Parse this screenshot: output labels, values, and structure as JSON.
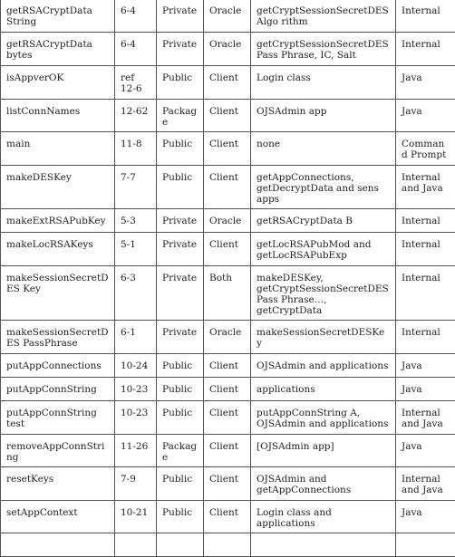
{
  "table": {
    "rows": [
      {
        "method": "getRSACryptData String",
        "ref": "6-4",
        "access": "Private",
        "location": "Oracle",
        "called_by": "getCryptSessionSecretDESAlgo rithm",
        "used_by": "Internal"
      },
      {
        "method": "getRSACryptData bytes",
        "ref": "6-4",
        "access": "Private",
        "location": "Oracle",
        "called_by": "getCryptSessionSecretDESPass Phrase, IC, Salt",
        "used_by": "Internal"
      },
      {
        "method": "isAppverOK",
        "ref": "ref 12-6",
        "access": "Public",
        "location": "Client",
        "called_by": "Login class",
        "used_by": "Java"
      },
      {
        "method": "listConnNames",
        "ref": "12-62",
        "access": "Package",
        "location": "Client",
        "called_by": "OJSAdmin app",
        "used_by": "Java"
      },
      {
        "method": "main",
        "ref": "11-8",
        "access": "Public",
        "location": "Client",
        "called_by": "none",
        "used_by": "Command Prompt"
      },
      {
        "method": "makeDESKey",
        "ref": "7-7",
        "access": "Public",
        "location": "Client",
        "called_by": "getAppConnections, getDecryptData and sens apps",
        "used_by": "Internal and Java"
      },
      {
        "method": "makeExtRSAPubKey",
        "ref": "5-3",
        "access": "Private",
        "location": "Oracle",
        "called_by": "getRSACryptData B",
        "used_by": "Internal"
      },
      {
        "method": "makeLocRSAKeys",
        "ref": "5-1",
        "access": "Private",
        "location": "Client",
        "called_by": "getLocRSAPubMod and getLocRSAPubExp",
        "used_by": "Internal"
      },
      {
        "method": "makeSessionSecretDES Key",
        "ref": "6-3",
        "access": "Private",
        "location": "Both",
        "called_by": "makeDESKey, getCryptSessionSecretDESPass Phrase…, getCryptData",
        "used_by": "Internal"
      },
      {
        "method": "makeSessionSecretDES PassPhrase",
        "ref": "6-1",
        "access": "Private",
        "location": "Oracle",
        "called_by": "makeSessionSecretDESKey",
        "used_by": "Internal"
      },
      {
        "method": "putAppConnections",
        "ref": "10-24",
        "access": "Public",
        "location": "Client",
        "called_by": "OJSAdmin and applications",
        "used_by": "Java"
      },
      {
        "method": "putAppConnString",
        "ref": "10-23",
        "access": "Public",
        "location": "Client",
        "called_by": "applications",
        "used_by": "Java"
      },
      {
        "method": "putAppConnString test",
        "ref": "10-23",
        "access": "Public",
        "location": "Client",
        "called_by": "putAppConnString A, OJSAdmin and applications",
        "used_by": "Internal and Java"
      },
      {
        "method": "removeAppConnString",
        "ref": "11-26",
        "access": "Package",
        "location": "Client",
        "called_by": "[OJSAdmin app]",
        "used_by": "Java"
      },
      {
        "method": "resetKeys",
        "ref": "7-9",
        "access": "Public",
        "location": "Client",
        "called_by": "OJSAdmin and getAppConnections",
        "used_by": "Internal and Java"
      },
      {
        "method": "setAppContext",
        "ref": "10-21",
        "access": "Public",
        "location": "Client",
        "called_by": "Login class and applications",
        "used_by": "Java"
      },
      {
        "method": "",
        "ref": "",
        "access": "",
        "location": "",
        "called_by": "",
        "used_by": ""
      }
    ]
  }
}
